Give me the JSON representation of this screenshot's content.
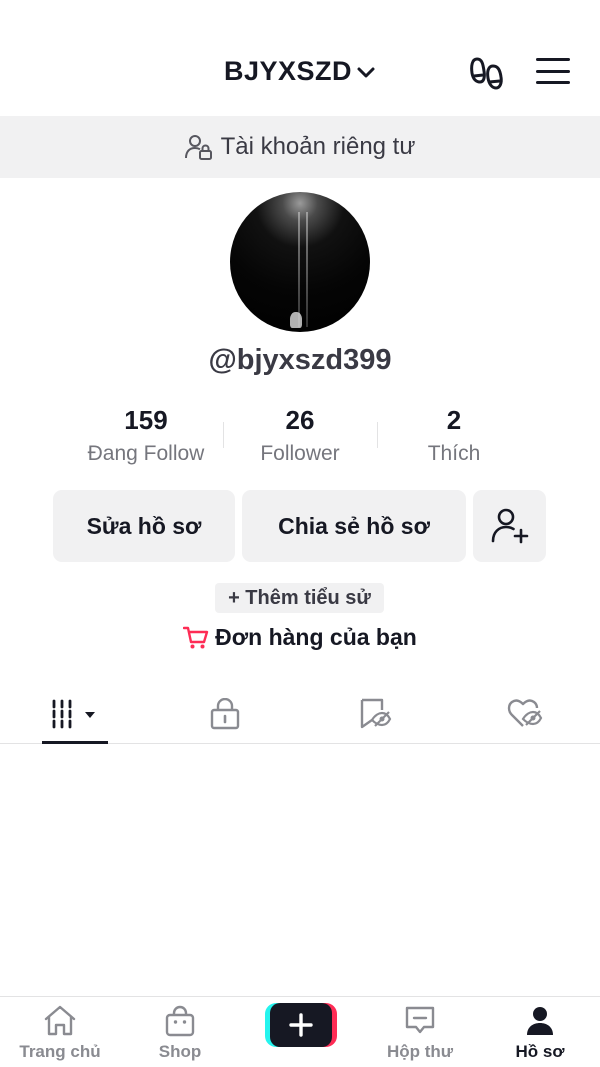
{
  "header": {
    "username": "BJYXSZD"
  },
  "private_banner": {
    "text": "Tài khoản riêng tư"
  },
  "profile": {
    "handle": "@bjyxszd399"
  },
  "stats": [
    {
      "value": "159",
      "label": "Đang Follow"
    },
    {
      "value": "26",
      "label": "Follower"
    },
    {
      "value": "2",
      "label": "Thích"
    }
  ],
  "actions": {
    "edit_profile": "Sửa hồ sơ",
    "share_profile": "Chia sẻ hồ sơ"
  },
  "bio_chip": "+ Thêm tiểu sử",
  "orders": {
    "label": "Đơn hàng của bạn",
    "icon_color": "#fe2c55"
  },
  "tabs": [
    {
      "icon": "grid-icon",
      "active": true
    },
    {
      "icon": "lock-icon"
    },
    {
      "icon": "bookmark-hidden-icon"
    },
    {
      "icon": "liked-hidden-icon"
    }
  ],
  "bottom_nav": {
    "home": "Trang chủ",
    "shop": "Shop",
    "inbox": "Hộp thư",
    "profile": "Hồ sơ"
  },
  "colors": {
    "accent": "#fe2c55",
    "cyan": "#25f4ee",
    "text": "#161823",
    "muted": "#75767d",
    "surface": "#f1f1f2"
  }
}
